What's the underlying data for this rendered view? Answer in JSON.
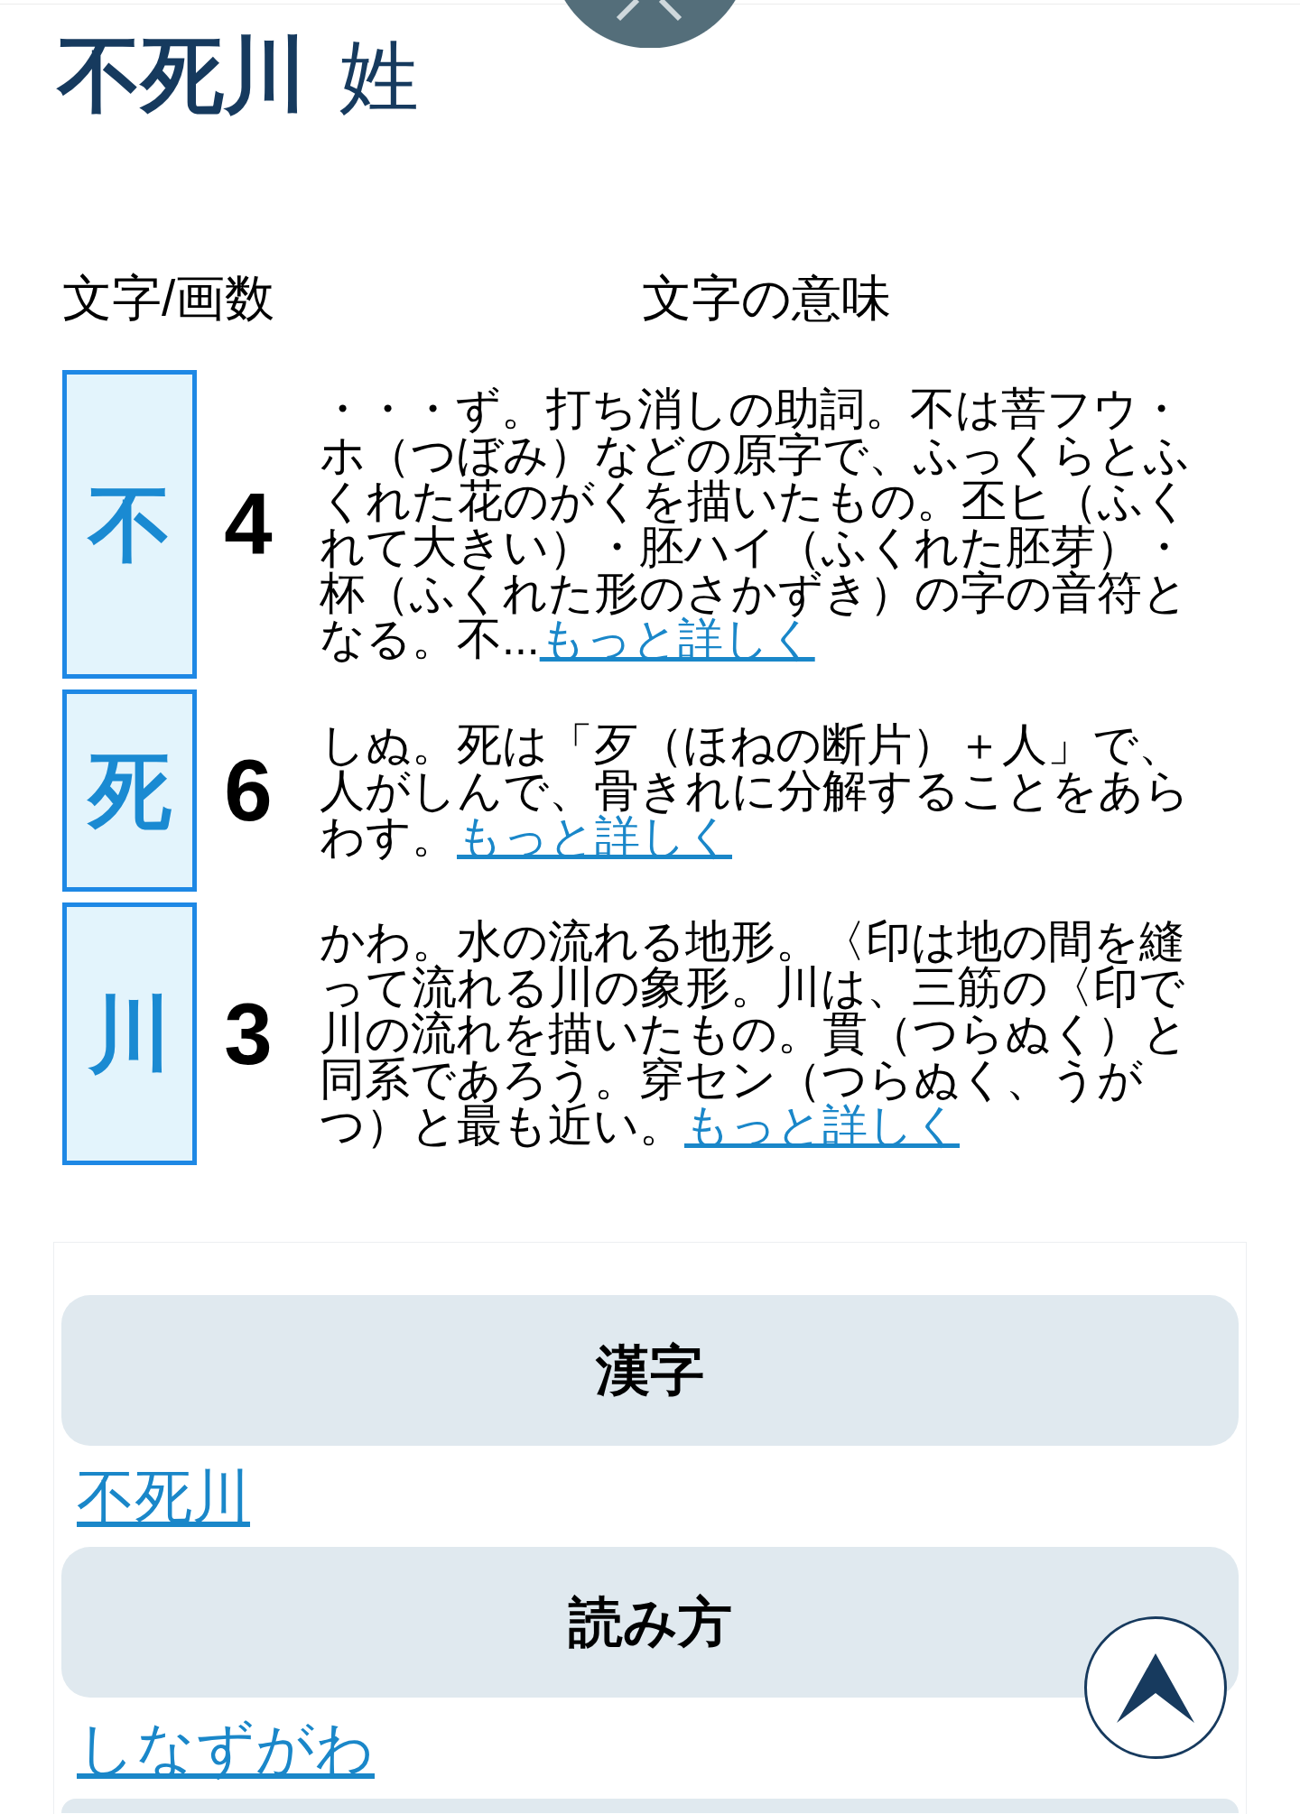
{
  "header": {
    "title": "不死川",
    "suffix": "姓"
  },
  "table": {
    "columns": [
      "文字/画数",
      "文字の意味"
    ],
    "rows": [
      {
        "character": "不",
        "strokes": "4",
        "meaning": "・・・ず。打ち消しの助詞。不は菩フウ・ホ（つぼみ）などの原字で、ふっくらとふくれた花のがくを描いたもの。丕ヒ（ふくれて大きい）・胚ハイ（ふくれた胚芽）・杯（ふくれた形のさかずき）の字の音符となる。不...",
        "link": "もっと詳しく"
      },
      {
        "character": "死",
        "strokes": "6",
        "meaning": "しぬ。死は「歹（ほねの断片）＋人」で、人がしんで、骨きれに分解することをあらわす。",
        "link": "もっと詳しく"
      },
      {
        "character": "川",
        "strokes": "3",
        "meaning": "かわ。水の流れる地形。〈印は地の間を縫って流れる川の象形。川は、三筋の〈印で川の流れを描いたもの。貫（つらぬく）と同系であろう。穿セン（つらぬく、うがつ）と最も近い。",
        "link": "もっと詳しく"
      }
    ]
  },
  "sections": [
    {
      "heading": "漢字",
      "link": "不死川"
    },
    {
      "heading": "読み方",
      "link": "しなずがわ"
    }
  ]
}
